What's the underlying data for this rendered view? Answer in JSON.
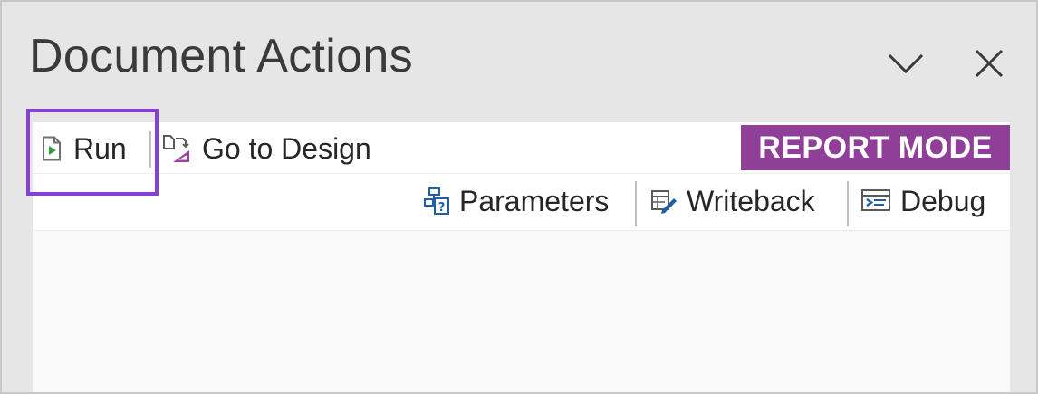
{
  "pane": {
    "title": "Document Actions",
    "collapse_icon": "chevron-down-icon",
    "close_icon": "close-icon"
  },
  "toolbar": {
    "run_label": "Run",
    "run_icon": "run-document-icon",
    "go_to_design_label": "Go to Design",
    "go_to_design_icon": "go-to-design-icon",
    "mode_badge": "REPORT MODE",
    "mode_badge_color": "#8f3f97",
    "parameters_label": "Parameters",
    "parameters_icon": "parameters-icon",
    "writeback_label": "Writeback",
    "writeback_icon": "writeback-icon",
    "debug_label": "Debug",
    "debug_icon": "debug-icon"
  },
  "highlight_color": "#8a3ed8"
}
